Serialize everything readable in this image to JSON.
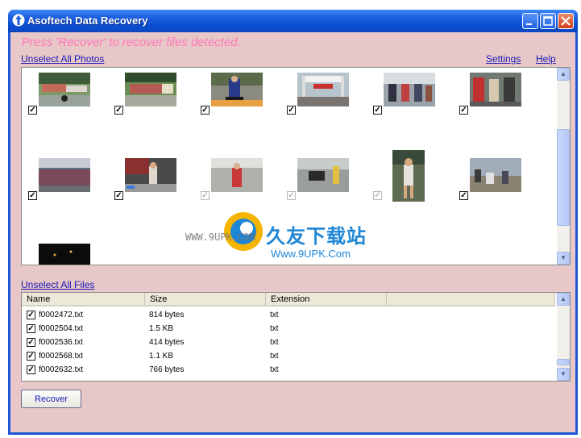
{
  "window": {
    "title": "Asoftech Data Recovery"
  },
  "header": {
    "hint": "Press 'Recover' to recover files detected.",
    "unselect_photos": "Unselect All Photos",
    "settings": "Settings",
    "help": "Help"
  },
  "photos": [
    {
      "checked": true
    },
    {
      "checked": true
    },
    {
      "checked": true
    },
    {
      "checked": true
    },
    {
      "checked": true
    },
    {
      "checked": true
    },
    {
      "checked": true
    },
    {
      "checked": true
    },
    {
      "checked": true
    },
    {
      "checked": true
    },
    {
      "checked": true
    },
    {
      "checked": true
    },
    {
      "checked": false
    }
  ],
  "watermark": {
    "www": "WWW.9UPK.COM",
    "site_name": "久友下载站",
    "url": "Www.9UPK.Com"
  },
  "files": {
    "unselect_label": "Unselect All Files",
    "columns": [
      "Name",
      "Size",
      "Extension"
    ],
    "rows": [
      {
        "name": "f0002472.txt",
        "size": "814 bytes",
        "ext": "txt",
        "checked": true
      },
      {
        "name": "f0002504.txt",
        "size": "1.5 KB",
        "ext": "txt",
        "checked": true
      },
      {
        "name": "f0002536.txt",
        "size": "414 bytes",
        "ext": "txt",
        "checked": true
      },
      {
        "name": "f0002568.txt",
        "size": "1.1 KB",
        "ext": "txt",
        "checked": true
      },
      {
        "name": "f0002632.txt",
        "size": "766 bytes",
        "ext": "txt",
        "checked": true
      }
    ]
  },
  "actions": {
    "recover": "Recover"
  }
}
